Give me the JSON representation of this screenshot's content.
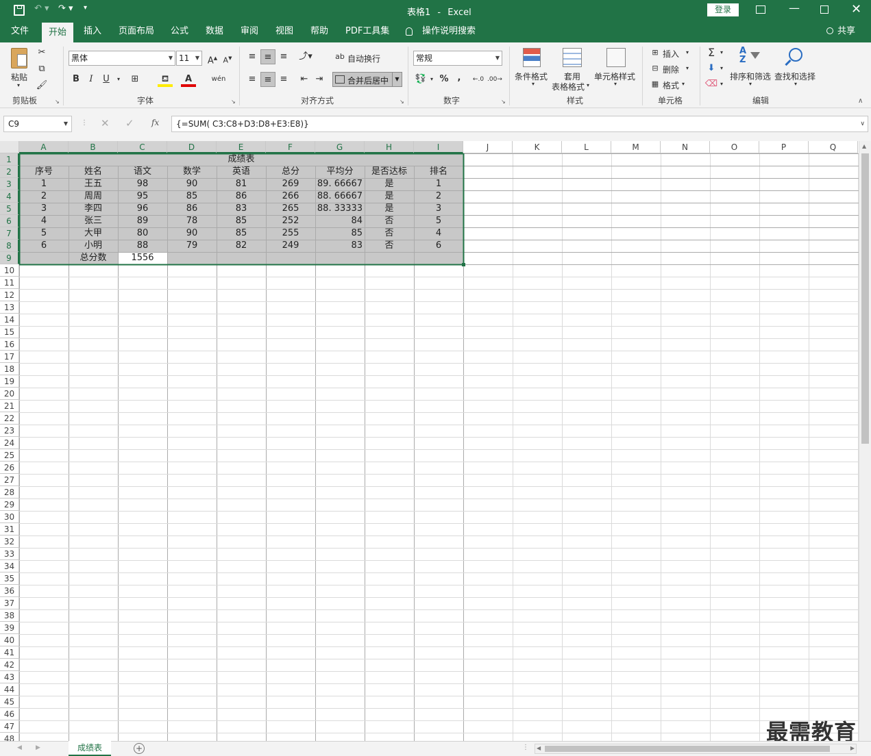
{
  "title": {
    "doc": "表格1",
    "sep": "-",
    "app": "Excel",
    "login": "登录"
  },
  "tabs": [
    "文件",
    "开始",
    "插入",
    "页面布局",
    "公式",
    "数据",
    "审阅",
    "视图",
    "帮助",
    "PDF工具集"
  ],
  "active_tab": "开始",
  "tellme": "操作说明搜索",
  "share": "共享",
  "ribbon": {
    "clipboard": {
      "paste": "粘贴",
      "group": "剪贴板"
    },
    "font": {
      "name": "黑体",
      "size": "11",
      "group": "字体",
      "bold": "B",
      "italic": "I",
      "underline": "U"
    },
    "align": {
      "wrap": "自动换行",
      "merge": "合并后居中",
      "group": "对齐方式"
    },
    "number": {
      "format": "常规",
      "group": "数字",
      "percent": "%",
      "comma": ","
    },
    "styles": {
      "cond": "条件格式",
      "table1": "套用",
      "table2": "表格格式",
      "cell": "单元格样式",
      "group": "样式"
    },
    "cells": {
      "insert": "插入",
      "delete": "删除",
      "format": "格式",
      "group": "单元格"
    },
    "editing": {
      "sort": "排序和筛选",
      "find": "查找和选择",
      "group": "编辑"
    }
  },
  "namebox": "C9",
  "formula": "{=SUM( C3:C8+D3:D8+E3:E8)}",
  "columns": [
    "A",
    "B",
    "C",
    "D",
    "E",
    "F",
    "G",
    "H",
    "I",
    "J",
    "K",
    "L",
    "M",
    "N",
    "O",
    "P",
    "Q"
  ],
  "sheet": {
    "title": "成绩表",
    "headers": [
      "序号",
      "姓名",
      "语文",
      "数学",
      "英语",
      "总分",
      "平均分",
      "是否达标",
      "排名"
    ],
    "rows": [
      [
        "1",
        "王五",
        "98",
        "90",
        "81",
        "269",
        "89. 66667",
        "是",
        "1"
      ],
      [
        "2",
        "周周",
        "95",
        "85",
        "86",
        "266",
        "88. 66667",
        "是",
        "2"
      ],
      [
        "3",
        "李四",
        "96",
        "86",
        "83",
        "265",
        "88. 33333",
        "是",
        "3"
      ],
      [
        "4",
        "张三",
        "89",
        "78",
        "85",
        "252",
        "84",
        "否",
        "5"
      ],
      [
        "5",
        "大甲",
        "80",
        "90",
        "85",
        "255",
        "85",
        "否",
        "4"
      ],
      [
        "6",
        "小明",
        "88",
        "79",
        "82",
        "249",
        "83",
        "否",
        "6"
      ]
    ],
    "total_label": "总分数",
    "total_value": "1556"
  },
  "sheet_tab": "成绩表",
  "watermark": "最需教育",
  "colors": {
    "excel_green": "#217346",
    "selection": "#c8c8c8"
  }
}
